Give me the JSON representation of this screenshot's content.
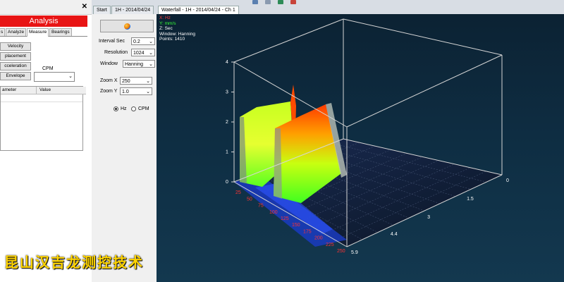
{
  "analysis": {
    "title": "Analysis",
    "tabs": [
      "s",
      "Analyze",
      "Measure",
      "Bearings"
    ],
    "active_tab": "Measure",
    "buttons": [
      "Velocity",
      "placement",
      "cceleration",
      "Envelope"
    ],
    "cpm_label": "CPM",
    "cpm_value": "",
    "table_headers": [
      "ameter",
      "Value"
    ]
  },
  "doc_tabs": [
    "Start",
    "1H - 2014/04/24",
    "Waterfall - 1H - 2014/04/24 - Ch 1"
  ],
  "active_doc_tab": "Waterfall - 1H - 2014/04/24 - Ch 1",
  "settings": {
    "interval_label": "Interval Sec",
    "interval_value": "0.2",
    "resolution_label": "Resolution",
    "resolution_value": "1024",
    "window_label": "Window",
    "window_value": "Hanning",
    "zoom_x_label": "Zoom X",
    "zoom_x_value": "250",
    "zoom_y_label": "Zoom Y",
    "zoom_y_value": "1.0",
    "unit_options": [
      "Hz",
      "CPM"
    ],
    "selected_unit": "Hz"
  },
  "plot_info": {
    "x_line": "X: Hz",
    "y_line": "Y: mm/s",
    "z_line": "Z: Sec",
    "window_line": "Window: Hanning",
    "points_line": "Points: 1410"
  },
  "chart_data": {
    "type": "waterfall-3d",
    "x_label": "Hz",
    "y_label": "mm/s",
    "z_label": "Sec",
    "y_ticks": [
      "0",
      "1",
      "2",
      "3",
      "4"
    ],
    "x_ticks": [
      "25",
      "50",
      "75",
      "100",
      "125",
      "150",
      "175",
      "200",
      "225",
      "250"
    ],
    "z_ticks": [
      "0",
      "1.5",
      "3",
      "4.4",
      "5.9"
    ],
    "ylim": [
      0,
      4
    ],
    "xlim": [
      0,
      250
    ],
    "zlim": [
      0,
      5.9
    ],
    "surfaces": [
      {
        "freq_hz": 20,
        "peak_mm_s": 3.0,
        "color_top": "#ff4400",
        "color_bottom": "#c8ff00"
      },
      {
        "freq_hz": 45,
        "peak_mm_s": 2.8,
        "color_top": "#ff5a00",
        "color_bottom": "#a8ff20"
      }
    ],
    "colors": {
      "tick_labels_x": "#ff3333",
      "tick_labels_other": "#ffffff",
      "box": "#d6d6d6"
    }
  },
  "watermark": "昆山汉吉龙测控技术"
}
